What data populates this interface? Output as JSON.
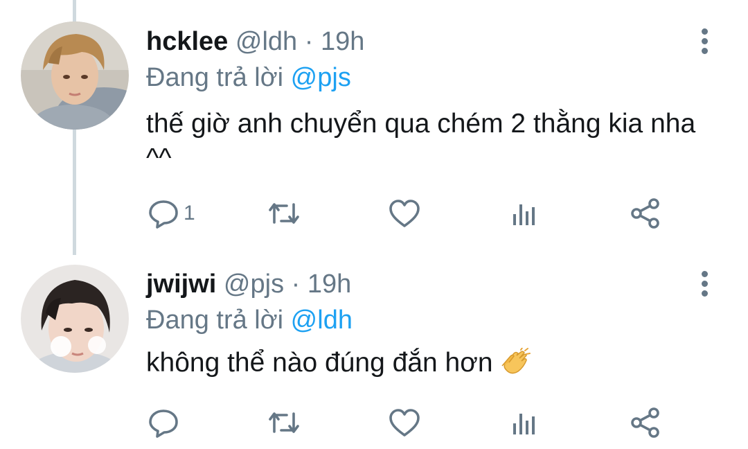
{
  "tweets": [
    {
      "display_name": "hcklee",
      "handle": "@ldh",
      "separator": "·",
      "time": "19h",
      "reply_prefix": "Đang trả lời",
      "reply_to": "@pjs",
      "text": "thế giờ anh chuyển qua chém 2 thằng kia nha ^^",
      "reply_count": "1",
      "retweet_count": "",
      "like_count": ""
    },
    {
      "display_name": "jwijwi",
      "handle": "@pjs",
      "separator": "·",
      "time": "19h",
      "reply_prefix": "Đang trả lời",
      "reply_to": "@ldh",
      "text": "không thể nào đúng đắn hơn",
      "emoji": "clapping-hands",
      "reply_count": "",
      "retweet_count": "",
      "like_count": ""
    }
  ],
  "icons": {
    "reply": "reply-icon",
    "retweet": "retweet-icon",
    "like": "heart-icon",
    "stats": "analytics-icon",
    "share": "share-icon",
    "more": "more-vertical-icon"
  },
  "colors": {
    "text": "#14171a",
    "secondary": "#657786",
    "link": "#1da1f2",
    "thread_line": "#cfd9de"
  }
}
